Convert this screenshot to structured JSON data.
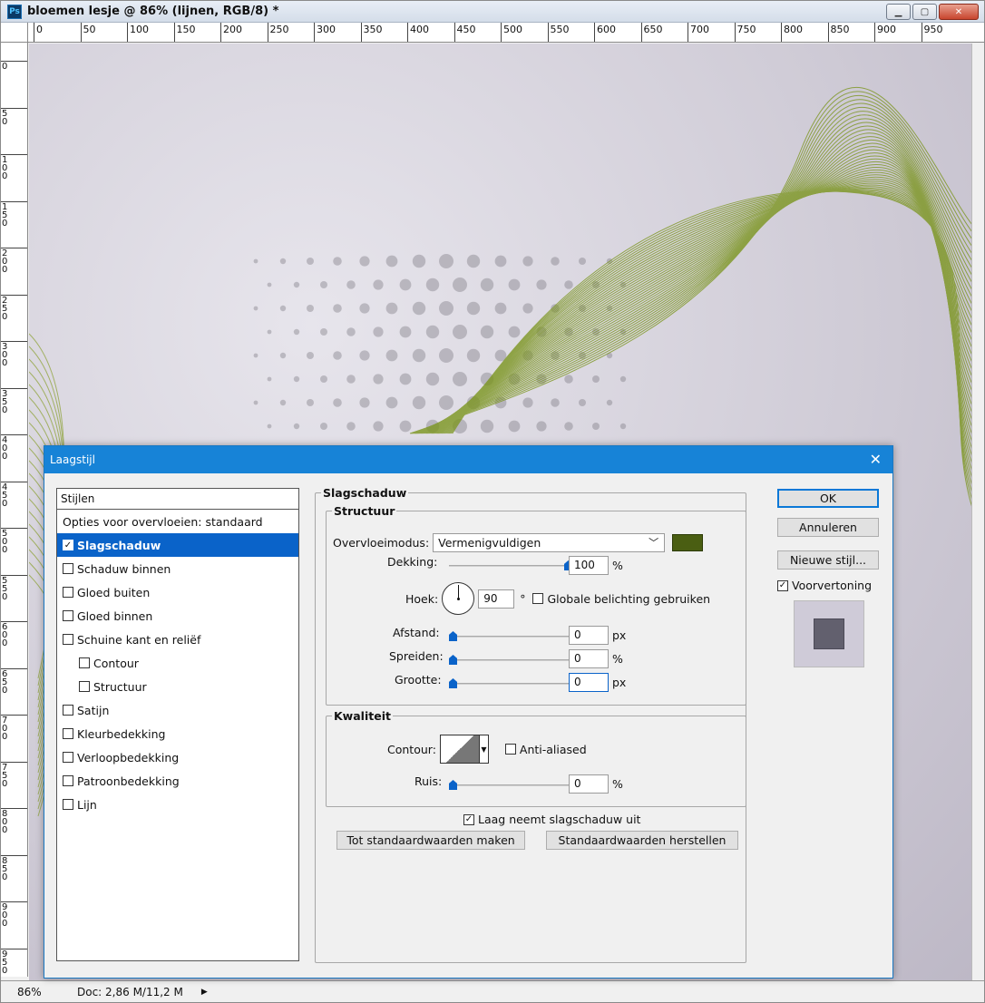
{
  "window": {
    "title": "bloemen lesje @ 86% (lijnen, RGB/8) *",
    "app_icon": "Ps"
  },
  "ruler": {
    "h_labels": [
      "0",
      "50",
      "100",
      "150",
      "200",
      "250",
      "300",
      "350",
      "400",
      "450",
      "500",
      "550",
      "600",
      "650",
      "700",
      "750",
      "800",
      "850",
      "900",
      "950"
    ],
    "v_labels": [
      "0",
      "50",
      "100",
      "150",
      "200",
      "250",
      "300",
      "350",
      "400",
      "450",
      "500",
      "550",
      "600",
      "650",
      "700",
      "750",
      "800",
      "850",
      "900",
      "950"
    ]
  },
  "status": {
    "zoom": "86%",
    "doc": "Doc: 2,86 M/11,2 M"
  },
  "dialog": {
    "title": "Laagstijl",
    "styles_header": "Stijlen",
    "blend_options": "Opties voor overvloeien: standaard",
    "items": [
      {
        "label": "Slagschaduw",
        "checked": true,
        "selected": true
      },
      {
        "label": "Schaduw binnen",
        "checked": false
      },
      {
        "label": "Gloed buiten",
        "checked": false
      },
      {
        "label": "Gloed binnen",
        "checked": false
      },
      {
        "label": "Schuine kant en reliëf",
        "checked": false
      },
      {
        "label": "Contour",
        "checked": false,
        "sub": true
      },
      {
        "label": "Structuur",
        "checked": false,
        "sub": true
      },
      {
        "label": "Satijn",
        "checked": false
      },
      {
        "label": "Kleurbedekking",
        "checked": false
      },
      {
        "label": "Verloopbedekking",
        "checked": false
      },
      {
        "label": "Patroonbedekking",
        "checked": false
      },
      {
        "label": "Lijn",
        "checked": false
      }
    ],
    "section_title": "Slagschaduw",
    "structure": {
      "title": "Structuur",
      "blend_label": "Overvloeimodus:",
      "blend_value": "Vermenigvuldigen",
      "shadow_color": "#4a5e12",
      "opacity_label": "Dekking:",
      "opacity_value": "100",
      "opacity_level": 1.0,
      "pct": "%",
      "angle_label": "Hoek:",
      "angle_value": "90",
      "deg": "°",
      "global_light": "Globale belichting gebruiken",
      "distance_label": "Afstand:",
      "distance_value": "0",
      "spread_label": "Spreiden:",
      "spread_value": "0",
      "size_label": "Grootte:",
      "size_value": "0",
      "px": "px"
    },
    "quality": {
      "title": "Kwaliteit",
      "contour_label": "Contour:",
      "anti_aliased": "Anti-aliased",
      "noise_label": "Ruis:",
      "noise_value": "0",
      "pct": "%"
    },
    "knockout": "Laag neemt slagschaduw uit",
    "make_default": "Tot standaardwaarden maken",
    "reset_default": "Standaardwaarden herstellen",
    "ok": "OK",
    "cancel": "Annuleren",
    "new_style": "Nieuwe stijl...",
    "preview_label": "Voorvertoning",
    "preview_checked": true
  }
}
